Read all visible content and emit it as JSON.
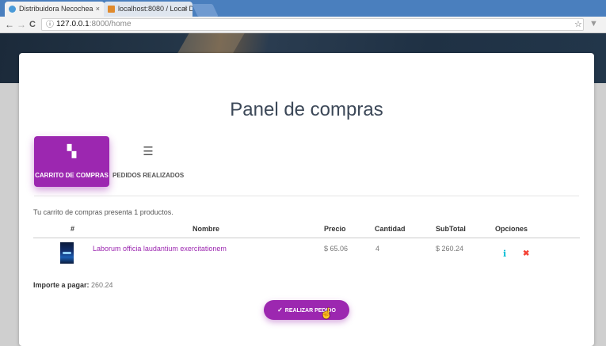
{
  "browser": {
    "tabs": [
      {
        "title": "Distribuidora Necochea",
        "close": "×"
      },
      {
        "title": "localhost:8080 / Local D...",
        "close": "×"
      }
    ],
    "nav": {
      "back": "←",
      "forward": "→",
      "reload": "C"
    },
    "address": {
      "host": "127.0.0.1",
      "path": ":8000/home"
    },
    "icons": {
      "info": "ⓘ",
      "star": "☆",
      "ext": "▼"
    }
  },
  "page": {
    "title": "Panel de compras",
    "tabs": [
      {
        "label": "CARRITO DE COMPRAS",
        "icon": "dashboard-icon",
        "glyph": "▚"
      },
      {
        "label": "PEDIDOS REALIZADOS",
        "icon": "list-icon",
        "glyph": "☰"
      }
    ],
    "summary": "Tu carrito de compras presenta 1 productos.",
    "table": {
      "headers": [
        "#",
        "Nombre",
        "Precio",
        "Cantidad",
        "SubTotal",
        "Opciones"
      ],
      "rows": [
        {
          "name": "Laborum officia laudantium exercitationem",
          "price": "$ 65.06",
          "quantity": "4",
          "subtotal": "$ 260.24"
        }
      ]
    },
    "total_label": "Importe a pagar:",
    "total_value": "260.24",
    "order_button": "REALIZAR PEDIDO",
    "option_icons": {
      "info": "i",
      "delete": "✖"
    }
  },
  "colors": {
    "accent": "#9c27b0",
    "info": "#00bcd4",
    "danger": "#f44336"
  }
}
